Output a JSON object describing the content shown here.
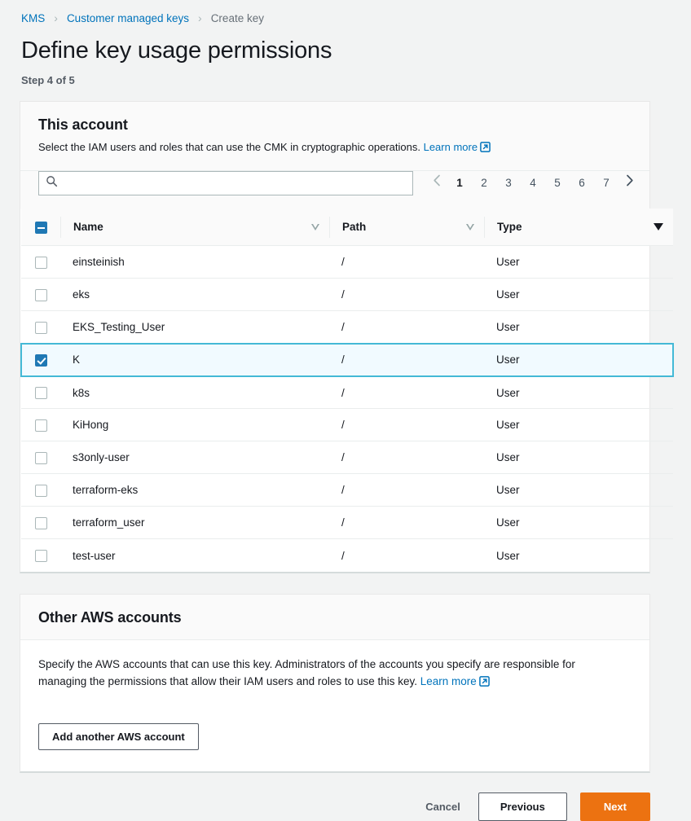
{
  "breadcrumb": {
    "items": [
      {
        "label": "KMS",
        "current": false
      },
      {
        "label": "Customer managed keys",
        "current": false
      },
      {
        "label": "Create key",
        "current": true
      }
    ],
    "separator": "›"
  },
  "page": {
    "title": "Define key usage permissions",
    "step": "Step 4 of 5"
  },
  "this_account": {
    "title": "This account",
    "description": "Select the IAM users and roles that can use the CMK in cryptographic operations.",
    "learn_more": "Learn more",
    "search": {
      "value": "",
      "placeholder": "",
      "icon": "search-icon"
    },
    "pagination": {
      "prev_icon": "chevron-left-icon",
      "next_icon": "chevron-right-icon",
      "pages": [
        "1",
        "2",
        "3",
        "4",
        "5",
        "6",
        "7"
      ],
      "active": "1"
    },
    "table": {
      "header_checkbox_state": "indeterminate",
      "columns": [
        {
          "label": "Name",
          "sort": "inactive"
        },
        {
          "label": "Path",
          "sort": "inactive"
        },
        {
          "label": "Type",
          "sort": "active-desc"
        }
      ],
      "rows": [
        {
          "name": "einsteinish",
          "path": "/",
          "type": "User",
          "selected": false
        },
        {
          "name": "eks",
          "path": "/",
          "type": "User",
          "selected": false
        },
        {
          "name": "EKS_Testing_User",
          "path": "/",
          "type": "User",
          "selected": false
        },
        {
          "name": "K",
          "path": "/",
          "type": "User",
          "selected": true
        },
        {
          "name": "k8s",
          "path": "/",
          "type": "User",
          "selected": false
        },
        {
          "name": "KiHong",
          "path": "/",
          "type": "User",
          "selected": false
        },
        {
          "name": "s3only-user",
          "path": "/",
          "type": "User",
          "selected": false
        },
        {
          "name": "terraform-eks",
          "path": "/",
          "type": "User",
          "selected": false
        },
        {
          "name": "terraform_user",
          "path": "/",
          "type": "User",
          "selected": false
        },
        {
          "name": "test-user",
          "path": "/",
          "type": "User",
          "selected": false
        }
      ]
    }
  },
  "other_accounts": {
    "title": "Other AWS accounts",
    "description": "Specify the AWS accounts that can use this key. Administrators of the accounts you specify are responsible for managing the permissions that allow their IAM users and roles to use this key.",
    "learn_more": "Learn more",
    "add_button": "Add another AWS account"
  },
  "footer": {
    "cancel": "Cancel",
    "previous": "Previous",
    "next": "Next"
  },
  "colors": {
    "accent_blue": "#0073bb",
    "primary_orange": "#ec7211",
    "selected_row_bg": "#f1faff",
    "selected_row_border": "#44b9d6",
    "checkbox_blue": "#1f78b4",
    "page_bg": "#f2f3f3"
  }
}
